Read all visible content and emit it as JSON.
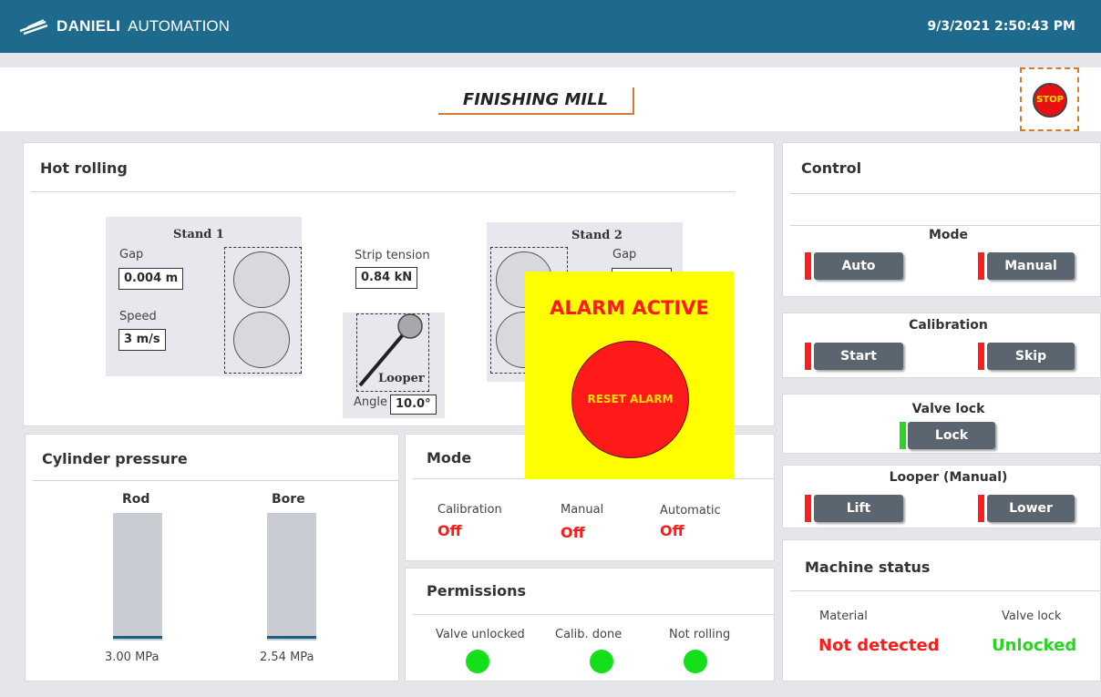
{
  "header": {
    "brand_bold": "DANIELI",
    "brand_light": "AUTOMATION",
    "datetime": "9/3/2021 2:50:43 PM"
  },
  "page": {
    "title": "FINISHING MILL",
    "stop_label": "STOP"
  },
  "hot_rolling": {
    "title": "Hot rolling",
    "stand1": {
      "title": "Stand 1",
      "gap_label": "Gap",
      "gap_value": "0.004 m",
      "speed_label": "Speed",
      "speed_value": "3 m/s"
    },
    "stand2": {
      "title": "Stand 2",
      "gap_label": "Gap"
    },
    "strip_tension_label": "Strip tension",
    "strip_tension_value": "0.84 kN",
    "looper_label": "Looper",
    "angle_label": "Angle",
    "angle_value": "10.0°"
  },
  "alarm": {
    "title": "ALARM ACTIVE",
    "reset_label": "RESET ALARM"
  },
  "control": {
    "title": "Control",
    "mode": {
      "title": "Mode",
      "auto": "Auto",
      "manual": "Manual"
    },
    "calibration": {
      "title": "Calibration",
      "start": "Start",
      "skip": "Skip"
    },
    "valve_lock": {
      "title": "Valve lock",
      "lock": "Lock"
    },
    "looper": {
      "title": "Looper (Manual)",
      "lift": "Lift",
      "lower": "Lower"
    }
  },
  "cylinder_pressure": {
    "title": "Cylinder pressure",
    "rod": {
      "label": "Rod",
      "value": "3.00 MPa"
    },
    "bore": {
      "label": "Bore",
      "value": "2.54 MPa"
    }
  },
  "mode_panel": {
    "title": "Mode",
    "calibration_label": "Calibration",
    "calibration_value": "Off",
    "manual_label": "Manual",
    "manual_value": "Off",
    "automatic_label": "Automatic",
    "automatic_value": "Off"
  },
  "permissions": {
    "title": "Permissions",
    "valve_unlocked": "Valve unlocked",
    "calib_done": "Calib. done",
    "not_rolling": "Not rolling"
  },
  "machine_status": {
    "title": "Machine status",
    "material_label": "Material",
    "material_value": "Not detected",
    "valve_lock_label": "Valve lock",
    "valve_lock_value": "Unlocked"
  },
  "colors": {
    "header_bg": "#1d6a8c",
    "alarm_bg": "#ffff00",
    "alarm_red": "#ff1a1a",
    "ok_green": "#27d61f",
    "accent_orange": "#d77c2c"
  }
}
